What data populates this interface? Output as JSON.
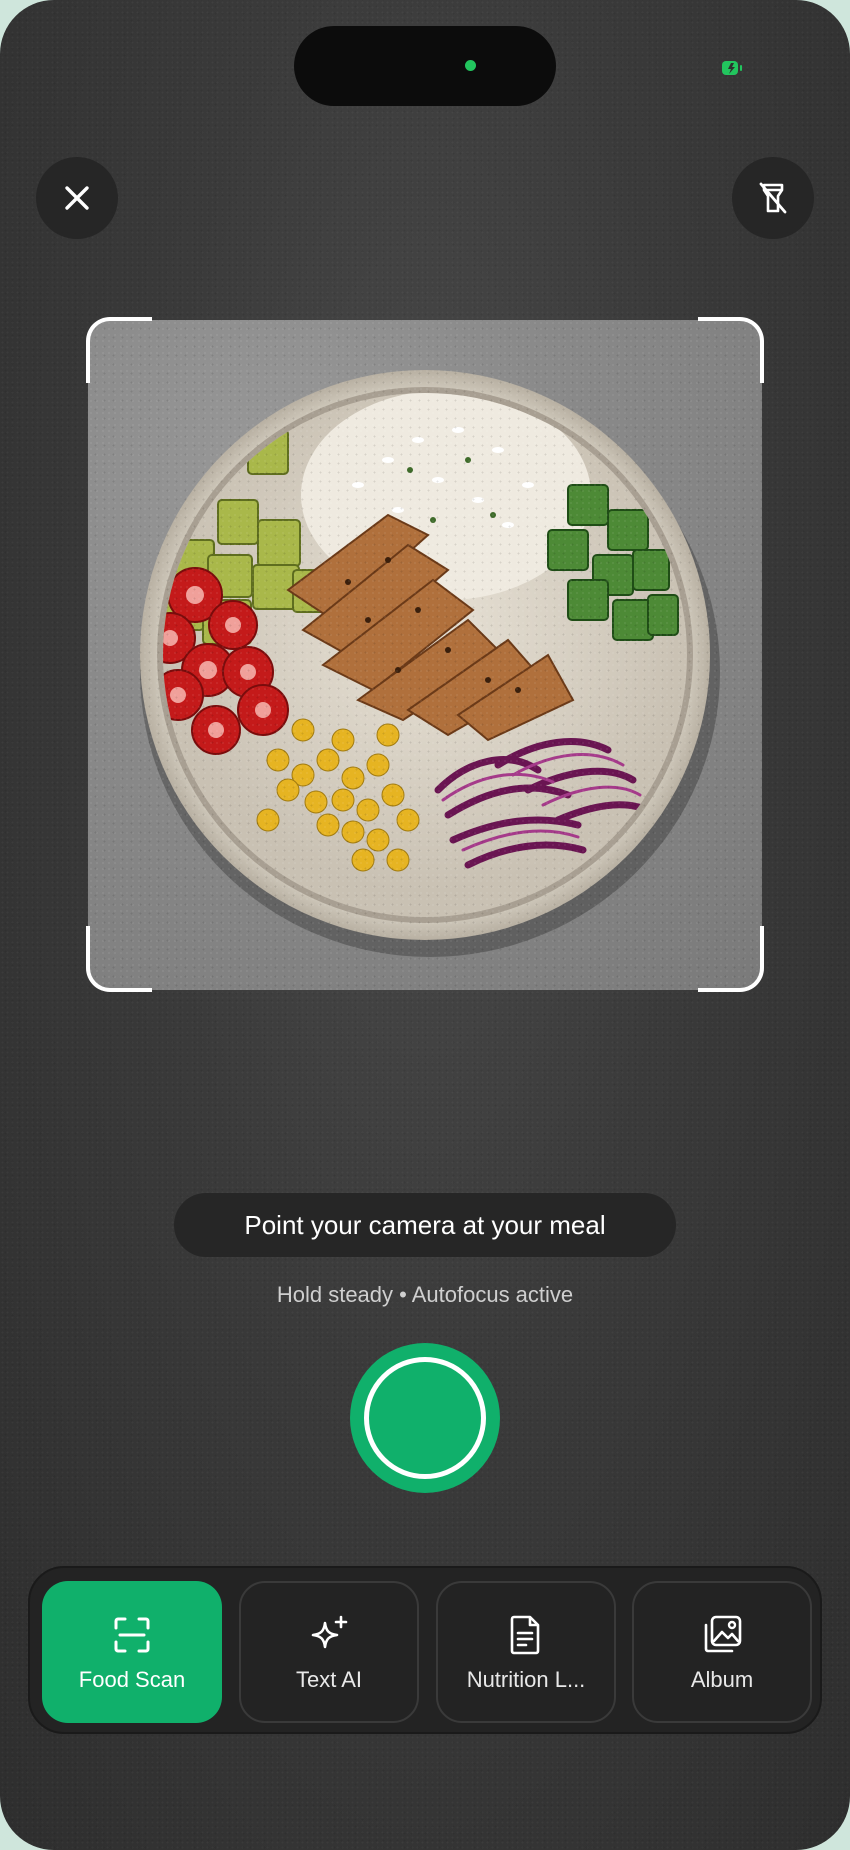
{
  "colors": {
    "accent": "#10b06b",
    "status_dot": "#22c55e",
    "battery": "#22c55e"
  },
  "status_bar": {
    "island": "dynamic-island",
    "battery_icon": "battery-charging-icon"
  },
  "header": {
    "close_icon": "close-icon",
    "flash_icon": "flash-off-icon"
  },
  "viewfinder": {
    "subject": "meal-bowl-photo"
  },
  "hints": {
    "primary": "Point your camera at your meal",
    "secondary": "Hold steady • Autofocus active"
  },
  "shutter": {
    "icon": "shutter-button"
  },
  "modes": [
    {
      "label": "Food Scan",
      "icon": "scan-frame-icon",
      "active": true
    },
    {
      "label": "Text AI",
      "icon": "sparkles-icon",
      "active": false
    },
    {
      "label": "Nutrition L...",
      "icon": "document-icon",
      "active": false
    },
    {
      "label": "Album",
      "icon": "photo-album-icon",
      "active": false
    }
  ]
}
